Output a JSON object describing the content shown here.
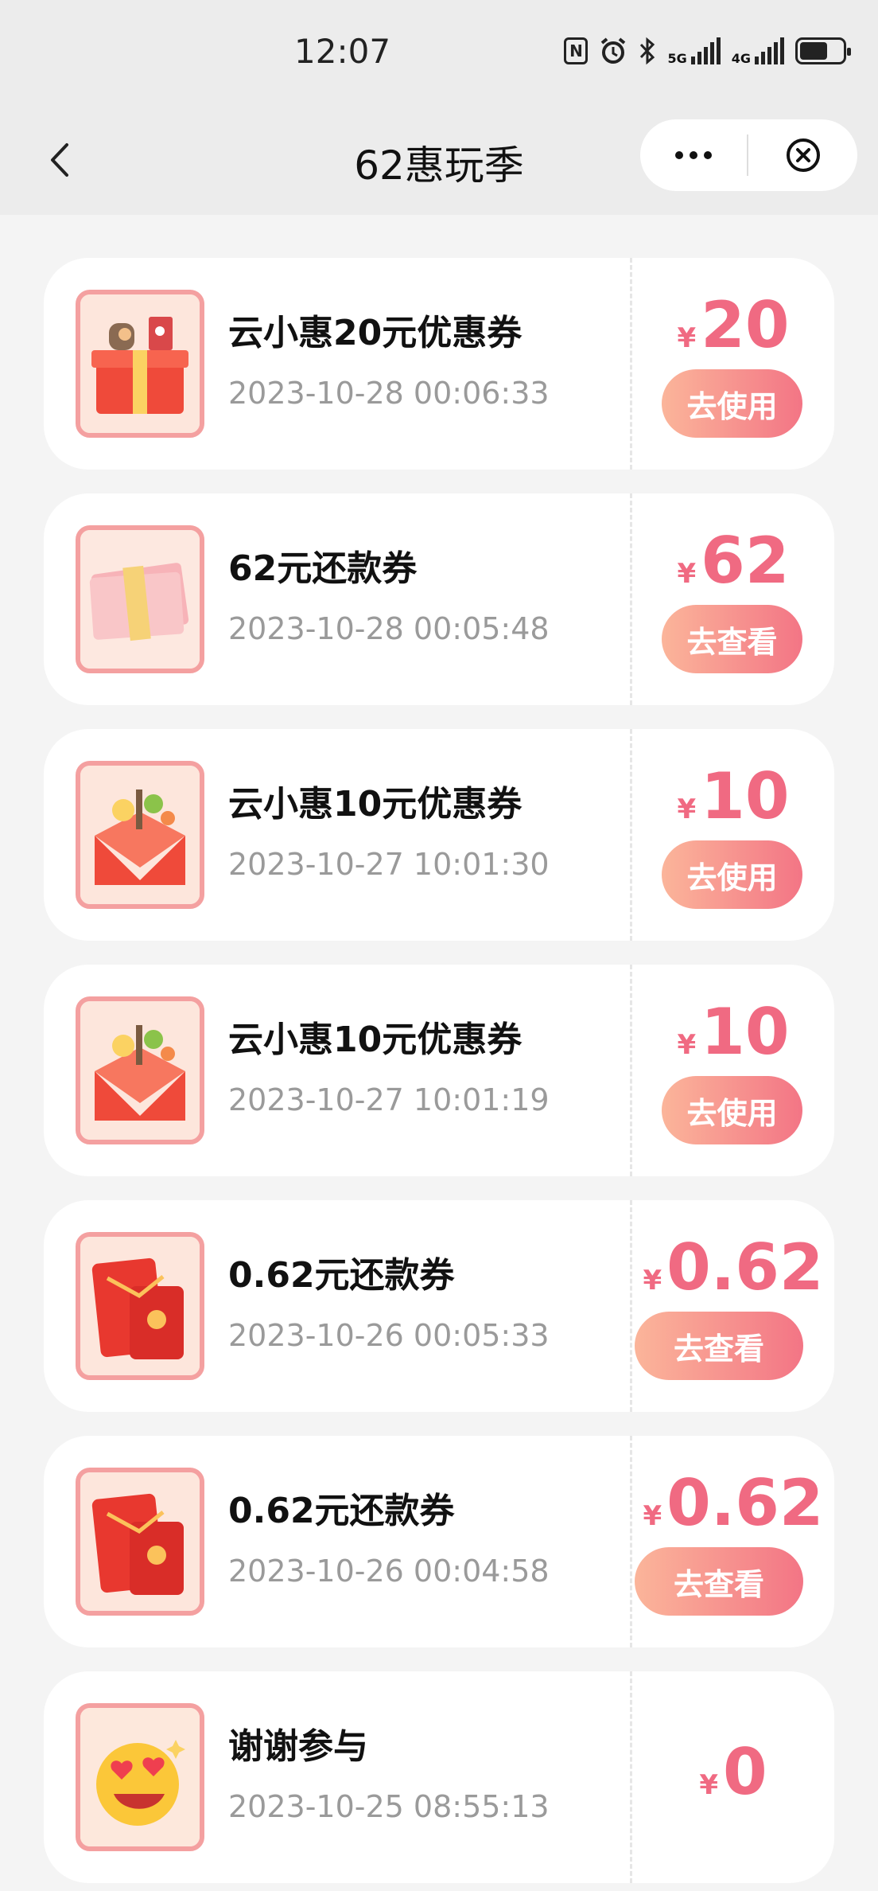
{
  "status_bar": {
    "time": "12:07",
    "icons": [
      "nfc-icon",
      "alarm-icon",
      "bluetooth-icon",
      "signal-5g-icon",
      "signal-4g-icon",
      "battery-icon"
    ],
    "signal_labels": {
      "first": "5G",
      "second": "4G"
    },
    "battery_level": 0.65
  },
  "nav": {
    "title": "62惠玩季"
  },
  "colors": {
    "accent": "#f06a82",
    "button_gradient_start": "#fbb59a",
    "button_gradient_end": "#f37585",
    "background": "#f4f4f4"
  },
  "rewards": [
    {
      "title": "云小惠20元优惠券",
      "time": "2023-10-28 00:06:33",
      "currency": "¥",
      "amount": "20",
      "action": "去使用",
      "icon": "gift-box-icon"
    },
    {
      "title": "62元还款券",
      "time": "2023-10-28 00:05:48",
      "currency": "¥",
      "amount": "62",
      "action": "去查看",
      "icon": "cash-stack-icon"
    },
    {
      "title": "云小惠10元优惠券",
      "time": "2023-10-27 10:01:30",
      "currency": "¥",
      "amount": "10",
      "action": "去使用",
      "icon": "gift-envelope-icon"
    },
    {
      "title": "云小惠10元优惠券",
      "time": "2023-10-27 10:01:19",
      "currency": "¥",
      "amount": "10",
      "action": "去使用",
      "icon": "gift-envelope-icon"
    },
    {
      "title": "0.62元还款券",
      "time": "2023-10-26 00:05:33",
      "currency": "¥",
      "amount": "0.62",
      "action": "去查看",
      "icon": "red-envelope-icon"
    },
    {
      "title": "0.62元还款券",
      "time": "2023-10-26 00:04:58",
      "currency": "¥",
      "amount": "0.62",
      "action": "去查看",
      "icon": "red-envelope-icon"
    },
    {
      "title": "谢谢参与",
      "time": "2023-10-25 08:55:13",
      "currency": "¥",
      "amount": "0",
      "icon": "heart-eyes-emoji-icon"
    }
  ]
}
